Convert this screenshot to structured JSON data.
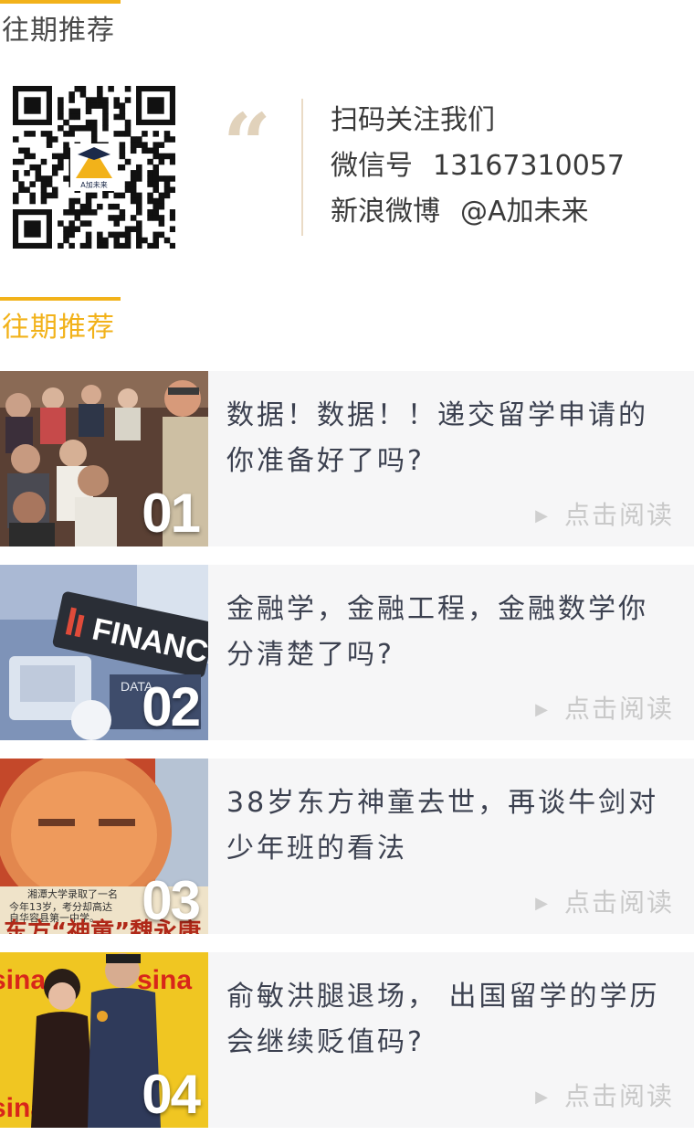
{
  "section1": {
    "title": "往期推荐"
  },
  "contact": {
    "scan_text": "扫码关注我们",
    "wechat_label": "微信号",
    "wechat_id": "13167310057",
    "weibo_label": "新浪微博",
    "weibo_handle": "@A加未来",
    "quote_mark": "“",
    "qr_logo_text": "A加未来"
  },
  "section2": {
    "title": "往期推荐"
  },
  "articles": [
    {
      "num": "01",
      "title": "数据！数据！！递交留学申请的你准备好了吗?",
      "more": "点击阅读",
      "more_icon": "play-triangle-icon"
    },
    {
      "num": "02",
      "title": "金融学，金融工程，金融数学你分清楚了吗?",
      "more": "点击阅读",
      "more_icon": "play-triangle-icon",
      "thumb_text": "FINANCE",
      "thumb_small": "DATA"
    },
    {
      "num": "03",
      "title": "38岁东方神童去世，再谈牛剑对少年班的看法",
      "more": "点击阅读",
      "more_icon": "play-triangle-icon",
      "thumb_caption": "湘潭大学录取了一名",
      "thumb_caption2": "今年13岁，考分却高达",
      "thumb_caption3": "自华容县第一中学。",
      "thumb_headline": "东方“神童”魏永康"
    },
    {
      "num": "04",
      "title": "俞敏洪腿退场， 出国留学的学历会继续贬值码?",
      "more": "点击阅读",
      "more_icon": "play-triangle-icon",
      "thumb_brand": "sina"
    }
  ],
  "colors": {
    "accent": "#f2b21a",
    "card_bg": "#f6f6f7",
    "title_text": "#3c4150",
    "muted": "#c9c9c9"
  }
}
